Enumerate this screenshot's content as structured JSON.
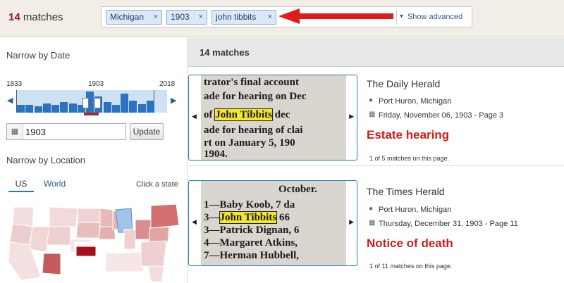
{
  "header": {
    "match_number": "14",
    "match_label": " matches"
  },
  "search": {
    "chips": [
      "Michigan",
      "1903",
      "john tibbits"
    ],
    "chip_remove": "×",
    "clear": "×",
    "show_advanced": "Show advanced"
  },
  "date_filter": {
    "title": "Narrow by Date",
    "start_year": "1833",
    "selected_year": "1903",
    "end_year": "2018",
    "input_value": "1903",
    "update_label": "Update",
    "histogram_fractions": [
      0.35,
      0.38,
      0.3,
      0.42,
      0.38,
      0.5,
      0.42,
      0.35,
      1.0,
      0.75,
      0.5,
      0.38,
      0.9,
      0.58,
      0.4,
      0.55
    ]
  },
  "location_filter": {
    "title": "Narrow by Location",
    "tab_us": "US",
    "tab_world": "World",
    "hint": "Click a state"
  },
  "results": {
    "header": "14 matches",
    "items": [
      {
        "publication": "The Daily Herald",
        "place": "Port Huron, Michigan",
        "date": "Friday, November 06, 1903 - Page 3",
        "annotation": "Estate hearing",
        "page_count": "1 of 5 matches on this page.",
        "clip_lines": [
          "trator's final account",
          "ade for hearing on Dec",
          "of ",
          "John Tibbits",
          " dec",
          "ade for hearing of clai",
          "rt on January 5, 190",
          " 1904."
        ]
      },
      {
        "publication": "The Times Herald",
        "place": "Port Huron, Michigan",
        "date": "Thursday, December 31, 1903 - Page 11",
        "annotation": "Notice of death",
        "page_count": "1 of 11 matches on this page.",
        "clip_lines": [
          "October.",
          "1—Baby Koob, 7 da",
          "3—",
          "John Tibbits",
          " 66",
          "3—Patrick Dignan, 6",
          "4—Margaret Atkins,",
          "7—Herman Hubbell,"
        ]
      }
    ]
  },
  "colors": {
    "accent_red": "#d11a1a",
    "brand_blue": "#2a73c0",
    "chip_bg": "#dbe8f5"
  }
}
